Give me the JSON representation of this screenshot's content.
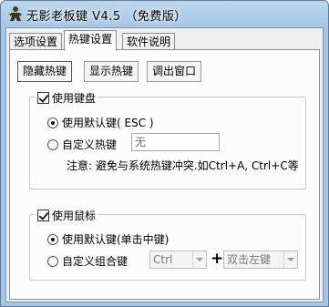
{
  "window": {
    "title": "无影老板键 V4.5 （免费版）"
  },
  "tabs": [
    {
      "label": "选项设置",
      "active": false
    },
    {
      "label": "热键设置",
      "active": true
    },
    {
      "label": "软件说明",
      "active": false
    }
  ],
  "subtabs": [
    {
      "label": "隐藏热键",
      "active": true
    },
    {
      "label": "显示热键",
      "active": false
    },
    {
      "label": "调出窗口",
      "active": false
    }
  ],
  "keyboard_group": {
    "label": "使用键盘",
    "checked": true,
    "option_default": "使用默认键( ESC )",
    "option_custom": "自定义热键",
    "custom_value": "无",
    "note": "注意: 避免与系统热键冲突.如Ctrl+A, Ctrl+C等"
  },
  "mouse_group": {
    "label": "使用鼠标",
    "checked": true,
    "option_default": "使用默认键(单击中键)",
    "option_custom": "自定义组合键",
    "modifier_value": "Ctrl",
    "plus": "+",
    "button_value": "双击左键"
  },
  "colors": {
    "titlebar": "#a6c5e3",
    "panel": "#fcfcfc"
  },
  "icons": {
    "app": "boss-figure-icon"
  }
}
